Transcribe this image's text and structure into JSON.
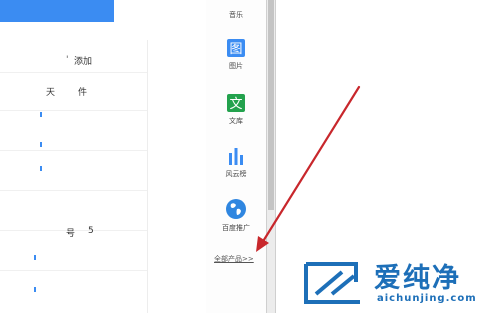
{
  "left_panel": {
    "add_label": "添加",
    "file_fragment": "件",
    "day_fragment": "天",
    "row_fragment_1": "号",
    "row_fragment_2": "5"
  },
  "products": [
    {
      "name": "音乐",
      "icon": "music-icon"
    },
    {
      "name": "图片",
      "icon": "picture-icon"
    },
    {
      "name": "文库",
      "icon": "wenku-icon"
    },
    {
      "name": "风云榜",
      "icon": "chart-icon"
    },
    {
      "name": "百度推广",
      "icon": "globe-icon"
    }
  ],
  "all_products_link": "全部产品>>",
  "watermark": {
    "title": "爱纯净",
    "url": "aichunjing.com"
  },
  "colors": {
    "accent_blue": "#3b8cf2",
    "wenku_green": "#23a24d",
    "arrow_red": "#c8272c",
    "watermark_blue": "#1d6fb8"
  }
}
